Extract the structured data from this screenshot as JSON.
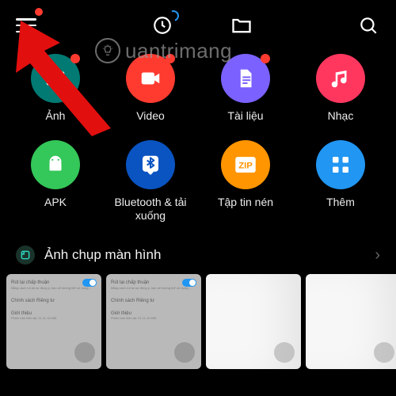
{
  "colors": {
    "notif": "#ff3b30",
    "blue": "#2196f3",
    "purple": "#7b61ff",
    "orange": "#ff9500",
    "teal": "#007a73",
    "pink": "#ff375f",
    "darkblue": "#0a54c2",
    "red": "#ff3b30",
    "green": "#34c759"
  },
  "watermark": {
    "text": "uantrimang"
  },
  "section": {
    "title": "Ảnh chụp màn hình",
    "badgeIcon": "screenshot-icon"
  },
  "categories": [
    {
      "id": "images",
      "label": "Ảnh",
      "color": "#007a73",
      "icon": "image",
      "dot": true
    },
    {
      "id": "video",
      "label": "Video",
      "color": "#ff3b30",
      "icon": "video",
      "dot": true
    },
    {
      "id": "docs",
      "label": "Tài liệu",
      "color": "#7b61ff",
      "icon": "doc",
      "dot": true
    },
    {
      "id": "music",
      "label": "Nhạc",
      "color": "#ff375f",
      "icon": "music",
      "dot": false
    },
    {
      "id": "apk",
      "label": "APK",
      "color": "#34c759",
      "icon": "android",
      "dot": false
    },
    {
      "id": "bluetooth",
      "label": "Bluetooth & tải xuống",
      "color": "#0a54c2",
      "icon": "bluetooth",
      "dot": false
    },
    {
      "id": "zip",
      "label": "Tập tin nén",
      "color": "#ff9500",
      "icon": "zip",
      "dot": false
    },
    {
      "id": "more",
      "label": "Thêm",
      "color": "#2196f3",
      "icon": "grid",
      "dot": false
    }
  ],
  "thumbs": [
    {
      "kind": "settings",
      "line1": "Rút lại chấp thuận",
      "line3": "Chính sách Riêng tư",
      "line4": "Giới thiệu"
    },
    {
      "kind": "settings",
      "line1": "Rút lại chấp thuận",
      "line3": "Chính sách Riêng tư",
      "line4": "Giới thiệu"
    },
    {
      "kind": "blank-light"
    },
    {
      "kind": "blank-light"
    }
  ]
}
